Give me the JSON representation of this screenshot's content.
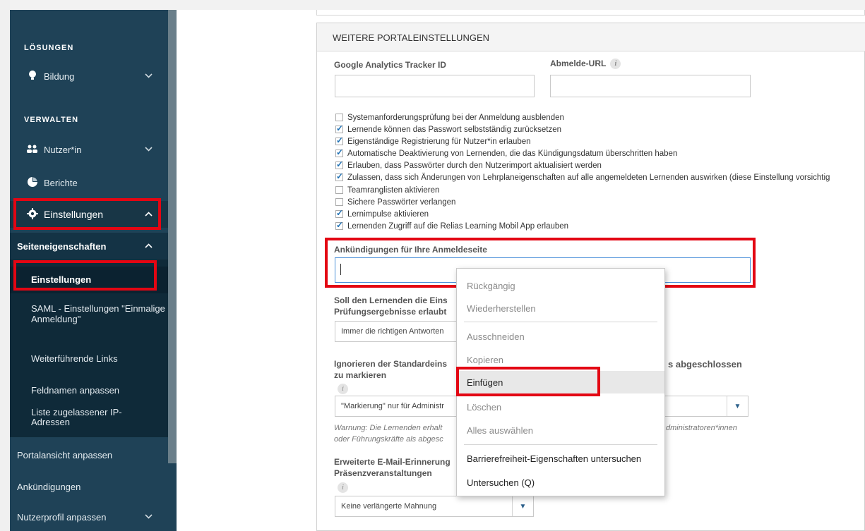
{
  "sidebar": {
    "section_solutions": "LÖSUNGEN",
    "bildung": "Bildung",
    "section_manage": "VERWALTEN",
    "nutzer": "Nutzer*in",
    "berichte": "Berichte",
    "einstellungen": "Einstellungen",
    "seiteneigenschaften": "Seiteneigenschaften",
    "sub_items": [
      "Einstellungen",
      "SAML - Einstellungen \"Einmalige Anmeldung\"",
      "Weiterführende Links",
      "Feldnamen anpassen",
      "Liste zugelassener IP-Adressen"
    ],
    "portalansicht": "Portalansicht anpassen",
    "ankuendigungen": "Ankündigungen",
    "nutzerprofil": "Nutzerprofil anpassen"
  },
  "panel": {
    "title": "WEITERE PORTALEINSTELLUNGEN",
    "ga_label": "Google Analytics Tracker ID",
    "logout_label": "Abmelde-URL",
    "info_glyph": "i",
    "checkboxes": [
      {
        "label": "Systemanforderungsprüfung bei der Anmeldung ausblenden",
        "checked": false
      },
      {
        "label": "Lernende können das Passwort selbstständig zurücksetzen",
        "checked": true
      },
      {
        "label": "Eigenständige Registrierung für Nutzer*in erlauben",
        "checked": true
      },
      {
        "label": "Automatische Deaktivierung von Lernenden, die das Kündigungsdatum überschritten haben",
        "checked": true
      },
      {
        "label": "Erlauben, dass Passwörter durch den Nutzerimport aktualisiert werden",
        "checked": true
      },
      {
        "label": "Zulassen, dass sich Änderungen von Lehrplaneigenschaften auf alle angemeldeten Lernenden auswirken (diese Einstellung vorsichtig",
        "checked": true
      },
      {
        "label": "Teamranglisten aktivieren",
        "checked": false
      },
      {
        "label": "Sichere Passwörter verlangen",
        "checked": false
      },
      {
        "label": "Lernimpulse aktivieren",
        "checked": true
      },
      {
        "label": "Lernenden Zugriff auf die Relias Learning Mobil App erlauben",
        "checked": true
      }
    ],
    "announce_label": "Ankündigungen für Ihre Anmeldeseite",
    "q1_line1": "Soll den Lernenden die Eins",
    "q1_line2": "Prüfungsergebnisse erlaubt",
    "q1_value": "Immer die richtigen Antworten",
    "q2_line1": "Ignorieren der Standardeins",
    "q2_line1_right": "s abgeschlossen",
    "q2_line2": "zu markieren",
    "q2_select_value": "\"Markierung\" nur für Administr",
    "warn_line1_left": "Warnung: Die Lernenden erhalt",
    "warn_line1_right": "dministratoren*innen",
    "warn_line2": "oder Führungskräfte als abgesc",
    "q3_line1": "Erweiterte E-Mail-Erinnerung",
    "q3_line2": "Präsenzveranstaltungen",
    "q3_select_value": "Keine verlängerte Mahnung",
    "select_arrow": "▼"
  },
  "context_menu": {
    "items": [
      {
        "label": "Rückgängig",
        "disabled": true
      },
      {
        "label": "Wiederherstellen",
        "disabled": true
      },
      {
        "label": "Ausschneiden",
        "disabled": true
      },
      {
        "label": "Kopieren",
        "disabled": true
      },
      {
        "label": "Einfügen",
        "disabled": false
      },
      {
        "label": "Löschen",
        "disabled": true
      },
      {
        "label": "Alles auswählen",
        "disabled": true
      },
      {
        "label": "Barrierefreiheit-Eigenschaften untersuchen",
        "disabled": false
      },
      {
        "label": "Untersuchen (Q)",
        "disabled": false
      }
    ]
  },
  "colors": {
    "sidebar_bg": "#1f4257",
    "highlight_red": "#e30613",
    "check_blue": "#1c6fb3"
  },
  "icons": {
    "bildung": "lightbulb-icon",
    "nutzer": "users-icon",
    "berichte": "pie-chart-icon",
    "einstellungen": "gear-icon",
    "chevron_down": "chevron-down-icon",
    "chevron_up": "chevron-up-icon"
  }
}
